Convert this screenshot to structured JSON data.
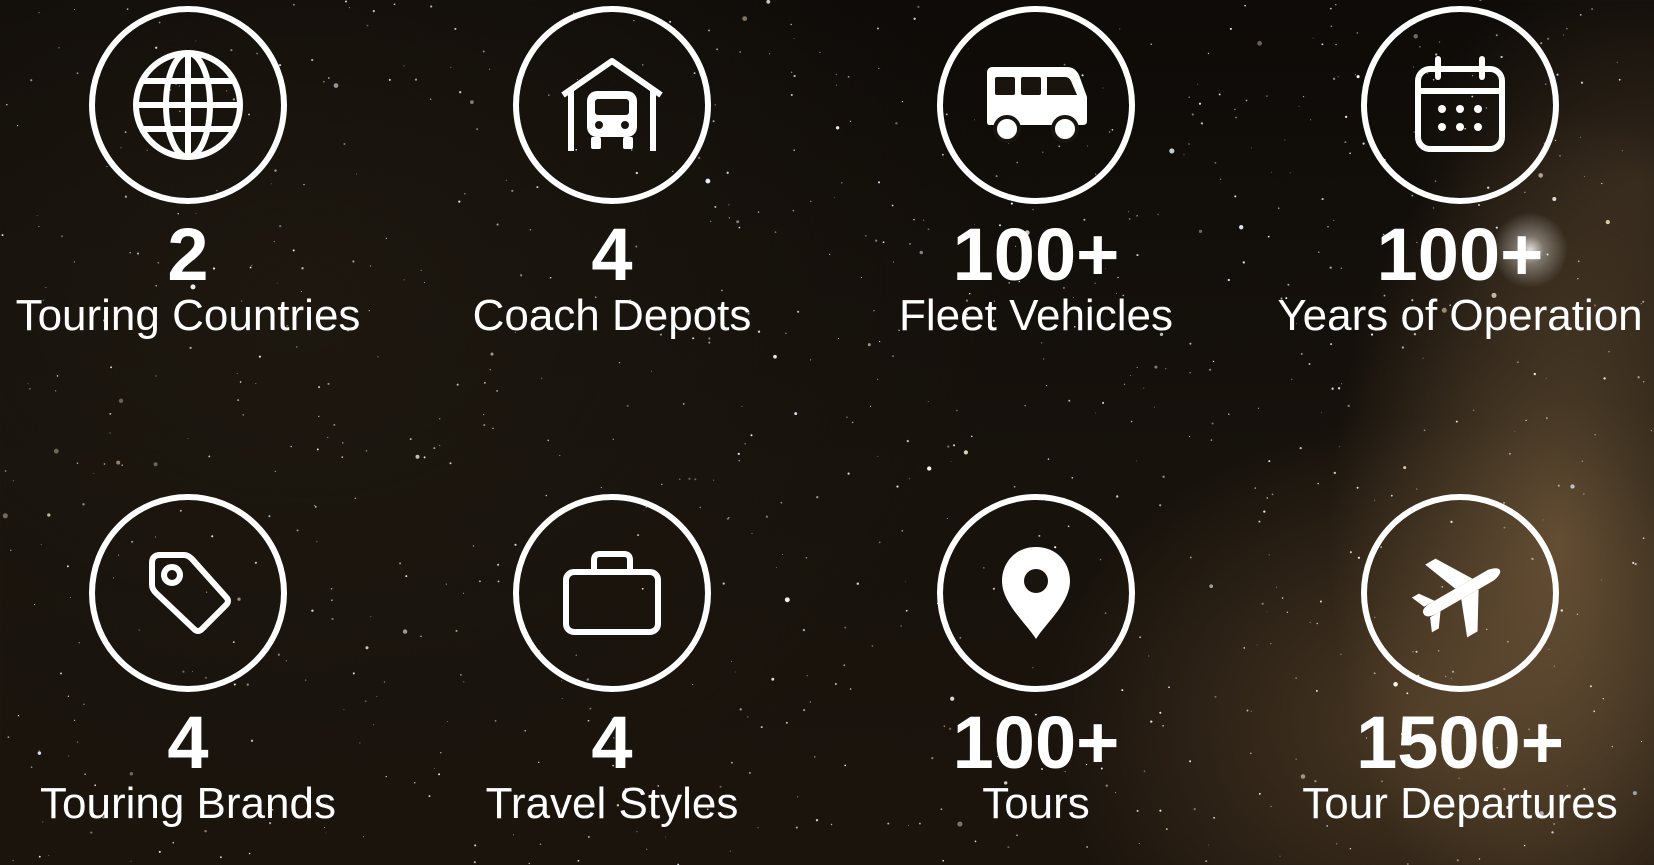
{
  "stats": [
    {
      "icon": "globe-icon",
      "value": "2",
      "label": "Touring Countries"
    },
    {
      "icon": "coach-depot-icon",
      "value": "4",
      "label": "Coach Depots"
    },
    {
      "icon": "bus-icon",
      "value": "100+",
      "label": "Fleet Vehicles"
    },
    {
      "icon": "calendar-icon",
      "value": "100+",
      "label": "Years of Operation"
    },
    {
      "icon": "tag-icon",
      "value": "4",
      "label": "Touring Brands"
    },
    {
      "icon": "briefcase-icon",
      "value": "4",
      "label": "Travel Styles"
    },
    {
      "icon": "map-pin-icon",
      "value": "100+",
      "label": "Tours"
    },
    {
      "icon": "airplane-icon",
      "value": "1500+",
      "label": "Tour Departures"
    }
  ],
  "colors": {
    "foreground": "#ffffff",
    "background": "#0f0c09"
  }
}
